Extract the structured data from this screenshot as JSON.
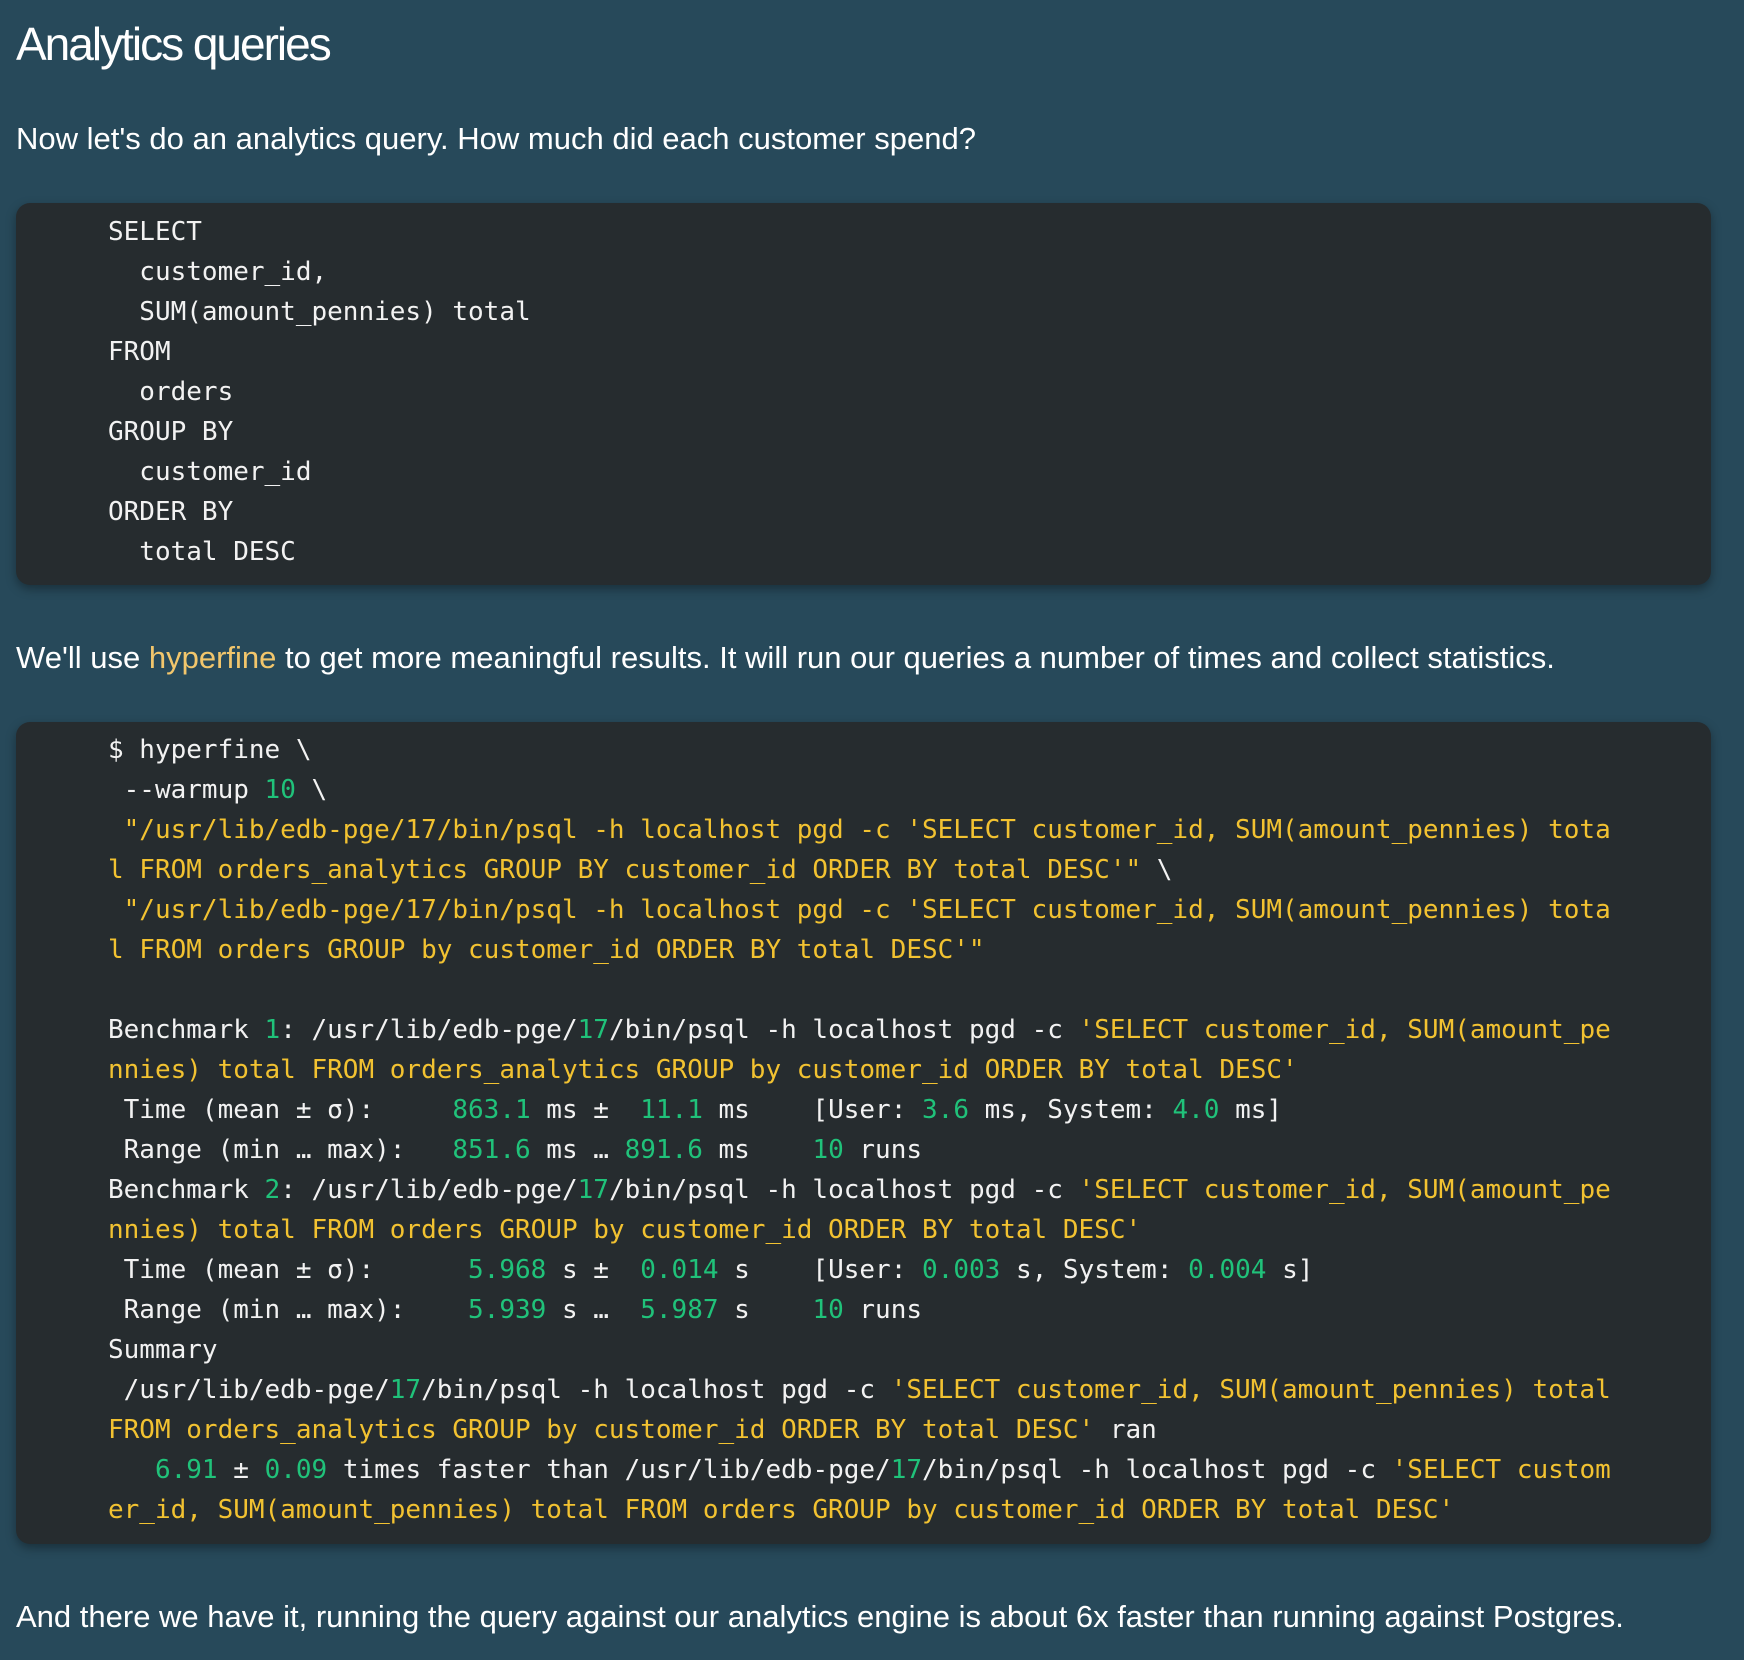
{
  "heading": "Analytics queries",
  "intro": "Now let's do an analytics query. How much did each customer spend?",
  "sql_lines": [
    "SELECT",
    "  customer_id,",
    "  SUM(amount_pennies) total",
    "FROM",
    "  orders",
    "GROUP BY",
    "  customer_id",
    "ORDER BY",
    "  total DESC"
  ],
  "hyperfine_para": {
    "before": "We'll use ",
    "link_text": "hyperfine",
    "after": " to get more meaningful results. It will run our queries a number of times and collect statistics."
  },
  "terminal_lines": [
    [
      {
        "t": "$ hyperfine \\"
      }
    ],
    [
      {
        "t": " --warmup "
      },
      {
        "t": "10",
        "c": "n"
      },
      {
        "t": " \\"
      }
    ],
    [
      {
        "t": " \"/usr/lib/edb-pge/17/bin/psql -h localhost pgd -c 'SELECT customer_id, SUM(amount_pennies) tota",
        "c": "s"
      }
    ],
    [
      {
        "t": "l FROM orders_analytics GROUP BY customer_id ORDER BY total DESC'\"",
        "c": "s"
      },
      {
        "t": " \\"
      }
    ],
    [
      {
        "t": " \"/usr/lib/edb-pge/17/bin/psql -h localhost pgd -c 'SELECT customer_id, SUM(amount_pennies) tota",
        "c": "s"
      }
    ],
    [
      {
        "t": "l FROM orders GROUP by customer_id ORDER BY total DESC'\"",
        "c": "s"
      }
    ],
    [
      {
        "t": ""
      }
    ],
    [
      {
        "t": "Benchmark "
      },
      {
        "t": "1",
        "c": "n"
      },
      {
        "t": ": /usr/lib/edb-pge/"
      },
      {
        "t": "17",
        "c": "n"
      },
      {
        "t": "/bin/psql -h localhost pgd -c "
      },
      {
        "t": "'SELECT customer_id, SUM(amount_pe",
        "c": "s"
      }
    ],
    [
      {
        "t": "nnies) total FROM orders_analytics GROUP by customer_id ORDER BY total DESC'",
        "c": "s"
      }
    ],
    [
      {
        "t": " Time (mean ± σ):     "
      },
      {
        "t": "863.1",
        "c": "n"
      },
      {
        "t": " ms ±  "
      },
      {
        "t": "11.1",
        "c": "n"
      },
      {
        "t": " ms    [User: "
      },
      {
        "t": "3.6",
        "c": "n"
      },
      {
        "t": " ms, System: "
      },
      {
        "t": "4.0",
        "c": "n"
      },
      {
        "t": " ms]"
      }
    ],
    [
      {
        "t": " Range (min … max):   "
      },
      {
        "t": "851.6",
        "c": "n"
      },
      {
        "t": " ms … "
      },
      {
        "t": "891.6",
        "c": "n"
      },
      {
        "t": " ms    "
      },
      {
        "t": "10",
        "c": "n"
      },
      {
        "t": " runs"
      }
    ],
    [
      {
        "t": "Benchmark "
      },
      {
        "t": "2",
        "c": "n"
      },
      {
        "t": ": /usr/lib/edb-pge/"
      },
      {
        "t": "17",
        "c": "n"
      },
      {
        "t": "/bin/psql -h localhost pgd -c "
      },
      {
        "t": "'SELECT customer_id, SUM(amount_pe",
        "c": "s"
      }
    ],
    [
      {
        "t": "nnies) total FROM orders GROUP by customer_id ORDER BY total DESC'",
        "c": "s"
      }
    ],
    [
      {
        "t": " Time (mean ± σ):      "
      },
      {
        "t": "5.968",
        "c": "n"
      },
      {
        "t": " s ±  "
      },
      {
        "t": "0.014",
        "c": "n"
      },
      {
        "t": " s    [User: "
      },
      {
        "t": "0.003",
        "c": "n"
      },
      {
        "t": " s, System: "
      },
      {
        "t": "0.004",
        "c": "n"
      },
      {
        "t": " s]"
      }
    ],
    [
      {
        "t": " Range (min … max):    "
      },
      {
        "t": "5.939",
        "c": "n"
      },
      {
        "t": " s …  "
      },
      {
        "t": "5.987",
        "c": "n"
      },
      {
        "t": " s    "
      },
      {
        "t": "10",
        "c": "n"
      },
      {
        "t": " runs"
      }
    ],
    [
      {
        "t": "Summary"
      }
    ],
    [
      {
        "t": " /usr/lib/edb-pge/"
      },
      {
        "t": "17",
        "c": "n"
      },
      {
        "t": "/bin/psql -h localhost pgd -c "
      },
      {
        "t": "'SELECT customer_id, SUM(amount_pennies) total",
        "c": "s"
      }
    ],
    [
      {
        "t": "FROM orders_analytics GROUP by customer_id ORDER BY total DESC'",
        "c": "s"
      },
      {
        "t": " ran"
      }
    ],
    [
      {
        "t": "   "
      },
      {
        "t": "6.91",
        "c": "n"
      },
      {
        "t": " ± "
      },
      {
        "t": "0.09",
        "c": "n"
      },
      {
        "t": " times faster than /usr/lib/edb-pge/"
      },
      {
        "t": "17",
        "c": "n"
      },
      {
        "t": "/bin/psql -h localhost pgd -c "
      },
      {
        "t": "'SELECT custom",
        "c": "s"
      }
    ],
    [
      {
        "t": "er_id, SUM(amount_pennies) total FROM orders GROUP by customer_id ORDER BY total DESC'",
        "c": "s"
      }
    ]
  ],
  "conclusion": "And there we have it, running the query against our analytics engine is about 6x faster than running against Postgres.",
  "colors": {
    "background": "#27495a",
    "code_background": "#262c2f",
    "number": "#20c27a",
    "string": "#f2c231",
    "link": "#f2c66c"
  }
}
